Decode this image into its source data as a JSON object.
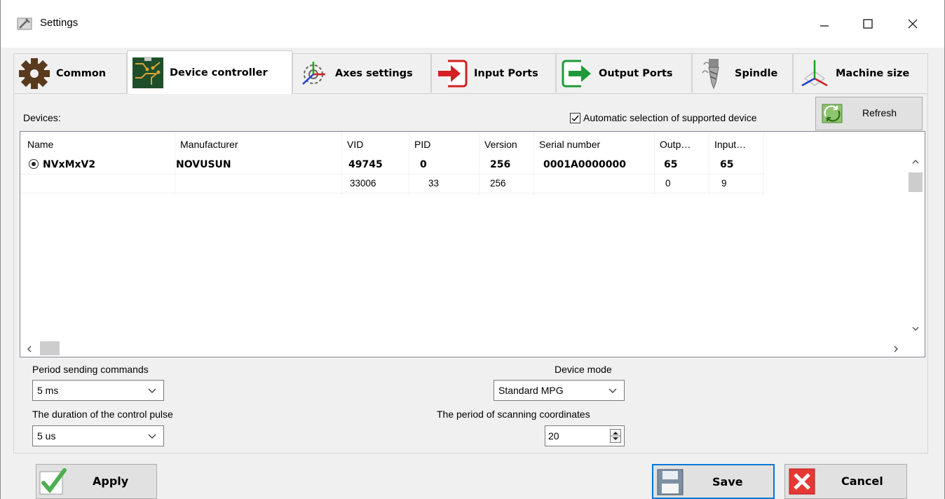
{
  "window": {
    "title": "Settings"
  },
  "tabs": [
    {
      "label": "Common",
      "icon": "gear-icon",
      "active": false
    },
    {
      "label": "Device controller",
      "icon": "circuit-board-icon",
      "active": true
    },
    {
      "label": "Axes settings",
      "icon": "axes-gear-icon",
      "active": false
    },
    {
      "label": "Input Ports",
      "icon": "input-arrow-icon",
      "active": false
    },
    {
      "label": "Output Ports",
      "icon": "output-arrow-icon",
      "active": false
    },
    {
      "label": "Spindle",
      "icon": "spindle-icon",
      "active": false
    },
    {
      "label": "Machine size",
      "icon": "machine-axes-icon",
      "active": false
    }
  ],
  "devices": {
    "label": "Devices:",
    "auto_select_label": "Automatic selection of supported device",
    "auto_select_checked": true,
    "refresh_label": "Refresh",
    "columns": [
      "Name",
      "Manufacturer",
      "VID",
      "PID",
      "Version",
      "Serial number",
      "Outp…",
      "Input…"
    ],
    "rows": [
      {
        "name": "NVxMxV2",
        "manufacturer": "NOVUSUN",
        "vid": "49745",
        "pid": "0",
        "version": "256",
        "serial": "0001A0000000",
        "outputs": "65",
        "inputs": "65",
        "selected": true
      },
      {
        "name": "",
        "manufacturer": "",
        "vid": "33006",
        "pid": "33",
        "version": "256",
        "serial": "",
        "outputs": "0",
        "inputs": "9",
        "selected": false
      }
    ]
  },
  "form": {
    "period_label": "Period sending commands",
    "period_value": "5 ms",
    "pulse_label": "The duration of the control pulse",
    "pulse_value": "5 us",
    "device_mode_label": "Device mode",
    "device_mode_value": "Standard MPG",
    "scan_label": "The period of scanning coordinates",
    "scan_value": "20"
  },
  "buttons": {
    "apply": "Apply",
    "save": "Save",
    "cancel": "Cancel"
  },
  "colors": {
    "accent": "#0078d7",
    "check_green": "#4caf50",
    "cancel_red": "#e53935"
  }
}
